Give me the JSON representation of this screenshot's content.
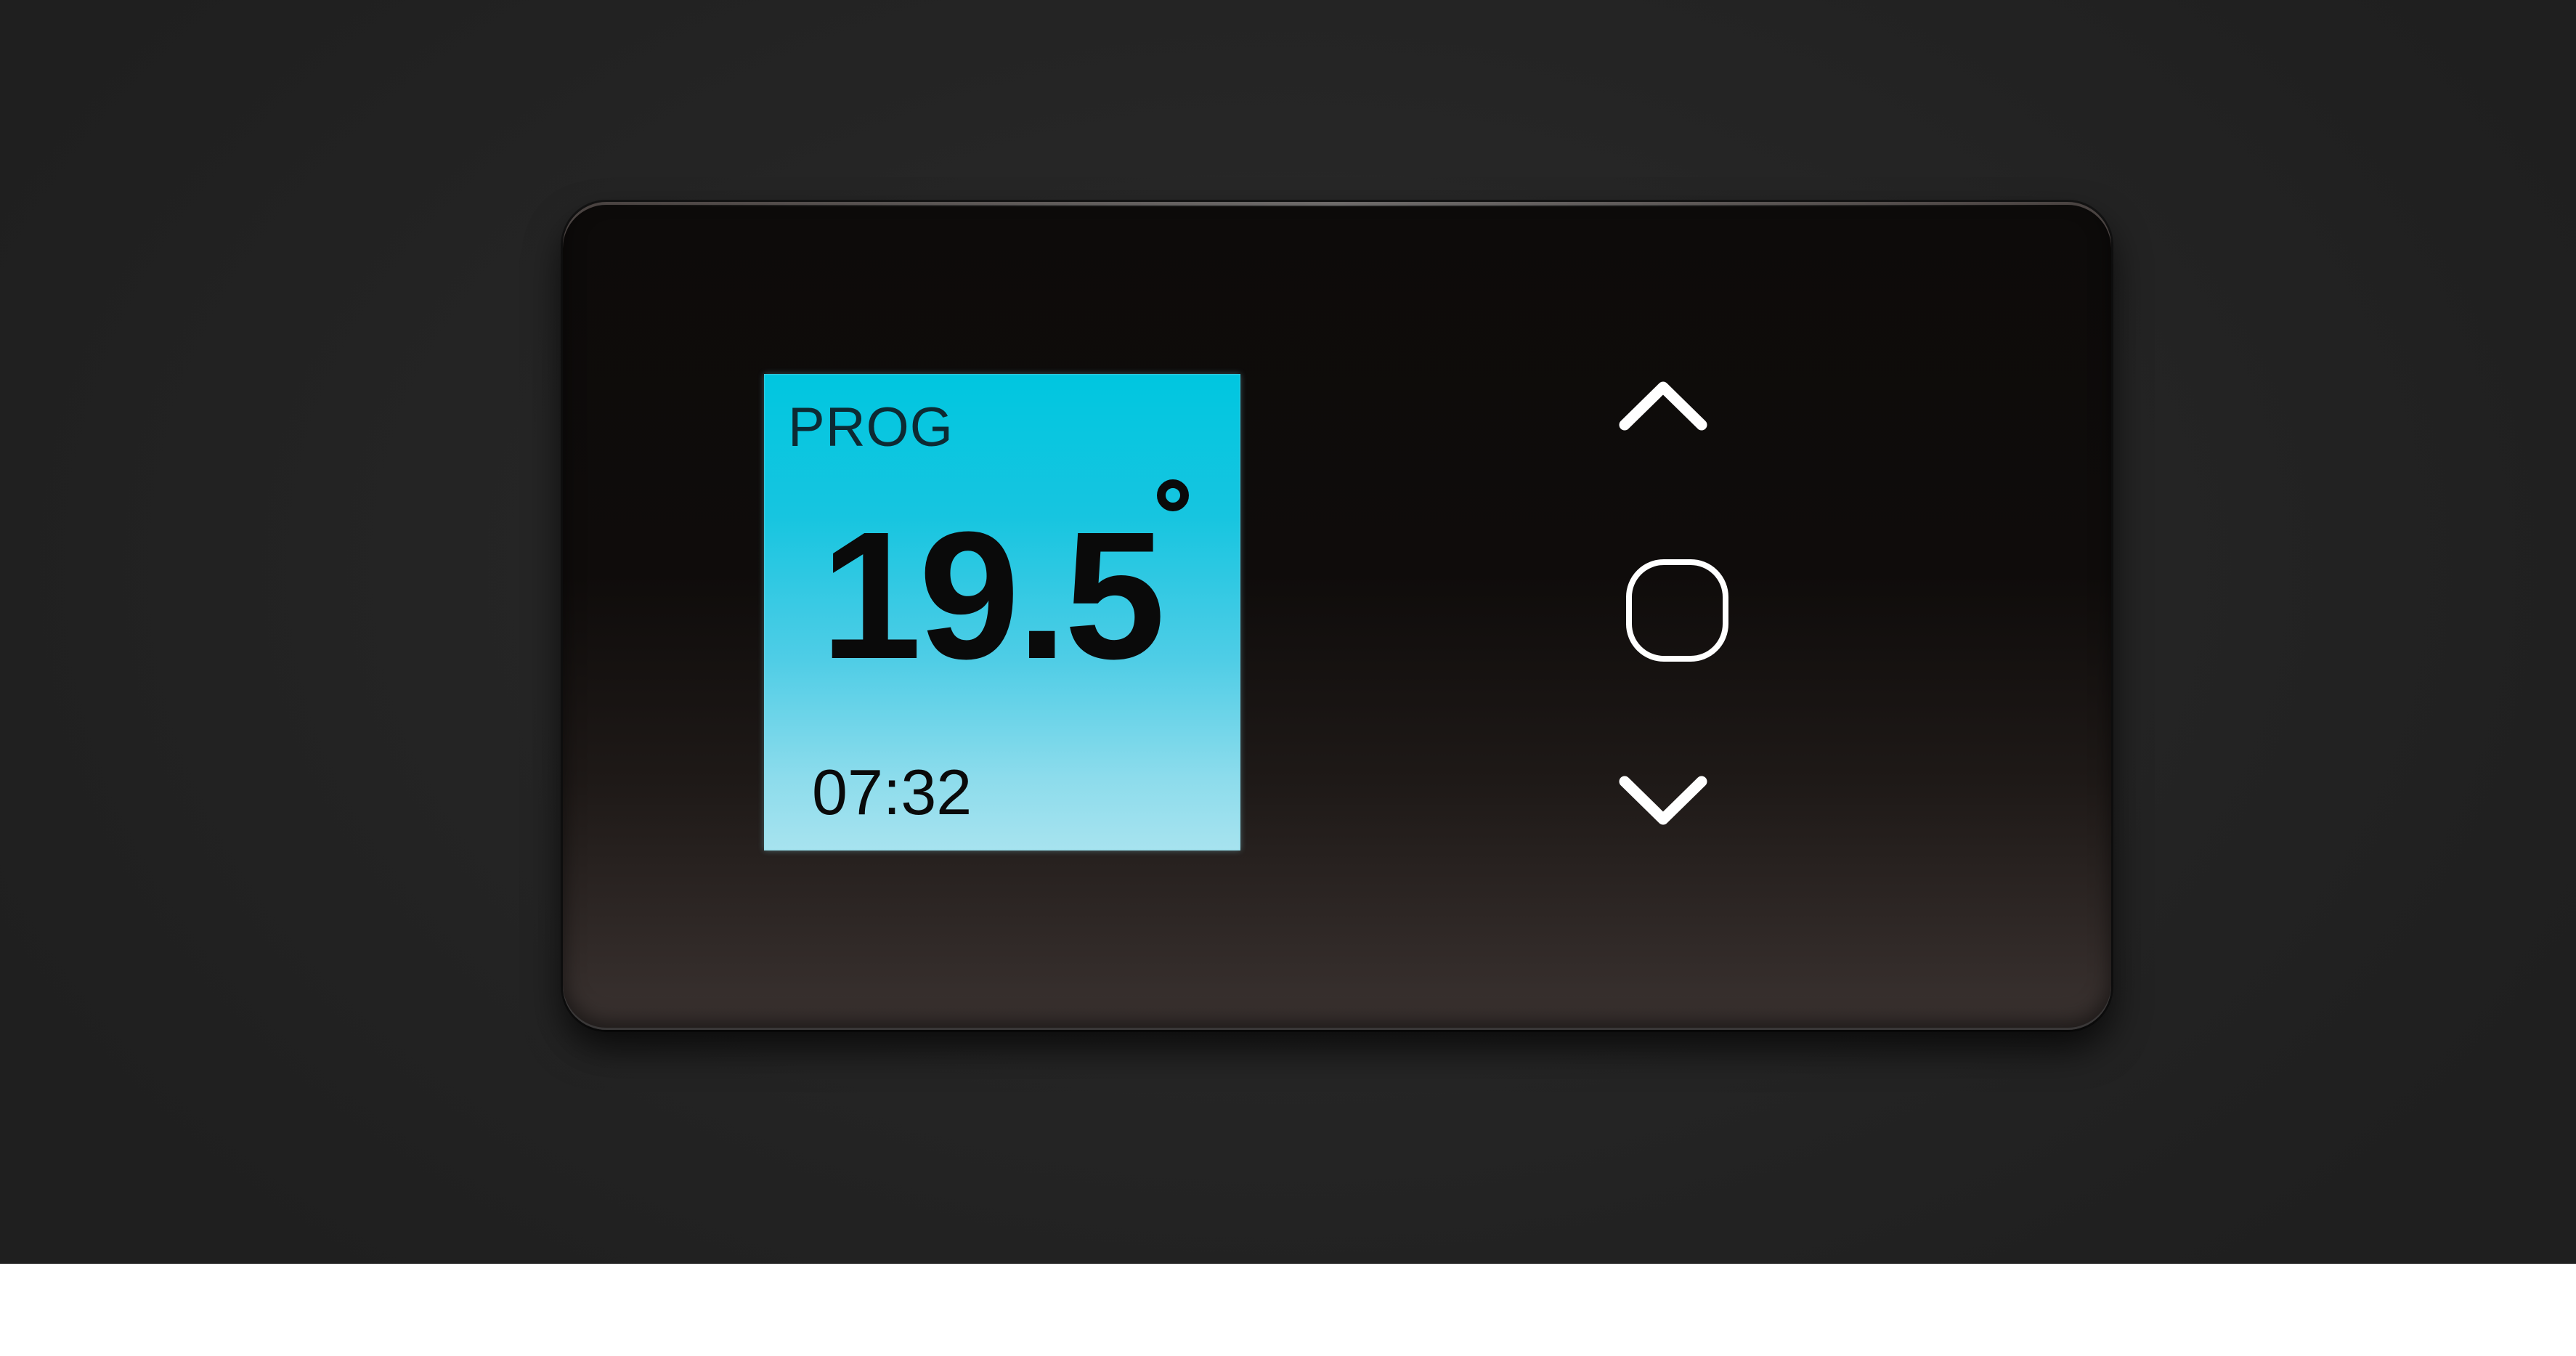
{
  "display": {
    "mode": "PROG",
    "temperature": "19.5",
    "time": "07:32"
  },
  "controls": {
    "up_icon": "chevron-up-icon",
    "ok_icon": "rounded-square-icon",
    "down_icon": "chevron-down-icon"
  },
  "colors": {
    "lcd_backlight": "#1fc8e2",
    "panel": "#0f0c0b",
    "icon": "#ffffff"
  }
}
